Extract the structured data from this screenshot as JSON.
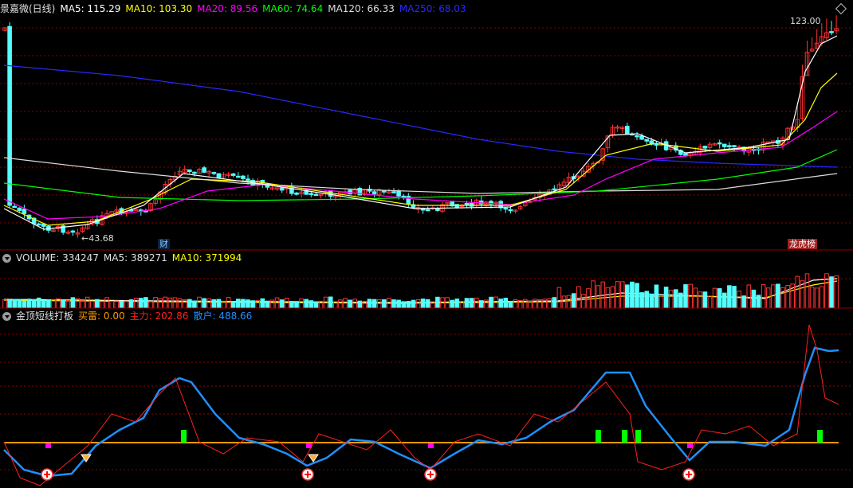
{
  "main_panel": {
    "title": "景嘉微(日线)",
    "ma_items": [
      {
        "label": "MA5: 115.29",
        "color": "#ffffff"
      },
      {
        "label": "MA10: 103.30",
        "color": "#ffff00"
      },
      {
        "label": "MA20: 89.56",
        "color": "#ff00ff"
      },
      {
        "label": "MA60: 74.64",
        "color": "#00ff00"
      },
      {
        "label": "MA120: 66.33",
        "color": "#dddddd"
      },
      {
        "label": "MA250: 68.03",
        "color": "#2828ff"
      }
    ],
    "high_label": "123.00",
    "low_label": "43.68",
    "flag_left": "财",
    "flag_right": "龙虎榜"
  },
  "volume_panel": {
    "title": "VOLUME: 334247",
    "ma5": "MA5: 389271",
    "ma10": "MA10: 371994"
  },
  "indicator_panel": {
    "title": "金顶短线打板",
    "buy": "买雷: 0.00",
    "main_force": "主力: 202.86",
    "retail": "散户: 488.66"
  },
  "colors": {
    "up": "#ff3232",
    "down": "#54ffff",
    "grid": "#8b0000",
    "zero_line": "#ff9900",
    "retail_line": "#1e90ff",
    "main_line": "#ff2020"
  }
}
